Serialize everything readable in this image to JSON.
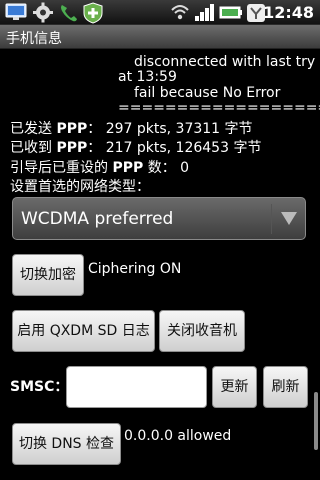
{
  "status_bar": {
    "icons": [
      "usb-debugging-icon",
      "settings-gear-icon",
      "phone-call-icon",
      "install-shield-icon",
      "wifi-icon",
      "signal-icon",
      "battery-icon",
      "app-y-icon"
    ],
    "time": "12:48"
  },
  "title_bar": {
    "title": "手机信息"
  },
  "log": {
    "line1": "disconnected with last try",
    "line2": "at 13:59",
    "line3": "fail because No Error",
    "line4": "=================="
  },
  "stats": {
    "sent_label": "已发送 ",
    "sent_ppp": "PPP",
    "sent_value": "： 297 pkts, 37311 字节",
    "recv_label": "已收到 ",
    "recv_ppp": "PPP",
    "recv_value": "： 217 pkts, 126453 字节",
    "reset_label": "引导后已重设的 ",
    "reset_ppp": "PPP",
    "reset_value": " 数： 0",
    "network_type_label": "设置首选的网络类型："
  },
  "network_spinner": {
    "selected": "WCDMA preferred"
  },
  "ciphering": {
    "button_label": "切换加密",
    "status": "Ciphering ON"
  },
  "qxdm_button": "启用 QXDM SD 日志",
  "radio_button": "关闭收音机",
  "smsc": {
    "label": "SMSC：",
    "value": "",
    "update_button": "更新",
    "refresh_button": "刷新"
  },
  "dns": {
    "button_label": "切换 DNS 检查",
    "status": "0.0.0.0 allowed"
  },
  "colors": {
    "background": "#000000",
    "button_bg": "#e6e6e6",
    "spinner_bg": "#555555",
    "text": "#ffffff"
  }
}
